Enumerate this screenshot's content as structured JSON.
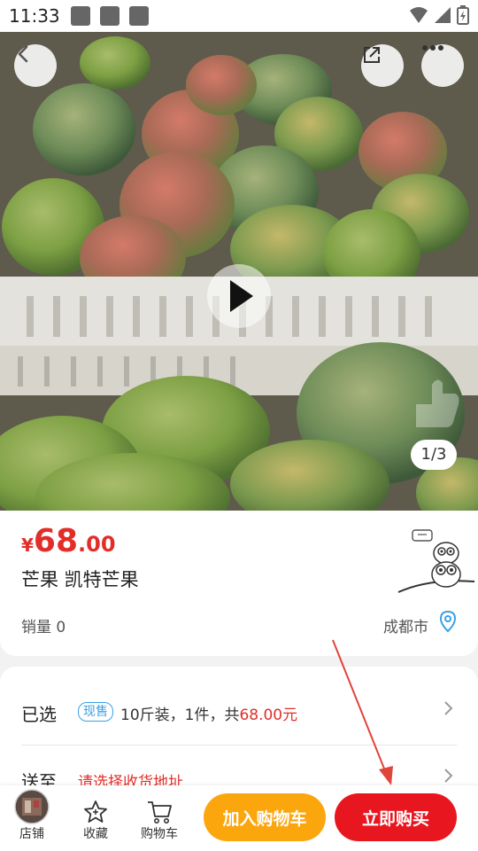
{
  "status_bar": {
    "time": "11:33"
  },
  "hero": {
    "counter": "1/3"
  },
  "product": {
    "price_symbol": "¥",
    "price_integer": "68",
    "price_decimal": ".00",
    "title": "芒果 凯特芒果",
    "sales": "销量 0",
    "city": "成都市"
  },
  "selection": {
    "selected_label": "已选",
    "badge": "现售",
    "detail_prefix": "10斤装，1件，共",
    "detail_price": "68.00元",
    "ship_label": "送至",
    "ship_value": "请选择收货地址"
  },
  "bottom_bar": {
    "store_label": "店铺",
    "favorite_label": "收藏",
    "cart_label": "购物车",
    "add_to_cart": "加入购物车",
    "buy_now": "立即购买"
  },
  "colors": {
    "price_red": "#e22e29",
    "buy_red": "#e8161f",
    "cart_orange": "#fca60e",
    "badge_blue": "#3aa0e8"
  }
}
